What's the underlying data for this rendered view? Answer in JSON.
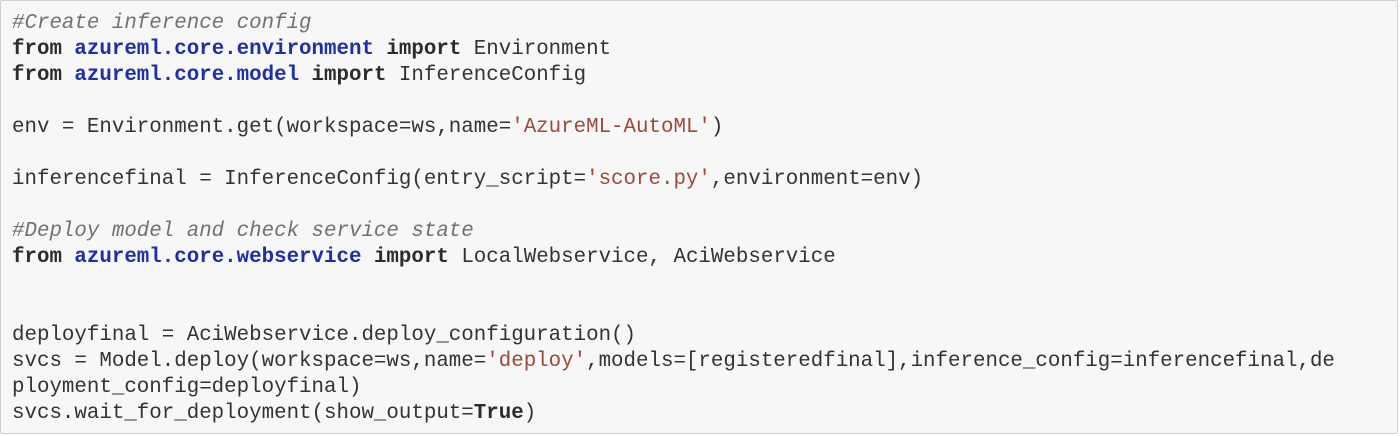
{
  "colors": {
    "background": "#f7f7f7",
    "border": "#cfcfcf",
    "text": "#333333",
    "comment": "#717171",
    "keyword": "#2c2c2c",
    "module": "#1e2fa8",
    "string": "#9a4a3a"
  },
  "code": {
    "l1": {
      "comment": "#Create inference config"
    },
    "l2": {
      "kw1": "from",
      "module": "azureml.core.environment",
      "kw2": "import",
      "name": "Environment"
    },
    "l3": {
      "kw1": "from",
      "module": "azureml.core.model",
      "kw2": "import",
      "name": "InferenceConfig"
    },
    "l5": {
      "pre": "env = Environment.get(workspace=ws,name=",
      "str": "'AzureML-AutoML'",
      "post": ")"
    },
    "l7": {
      "pre": "inferencefinal = InferenceConfig(entry_script=",
      "str": "'score.py'",
      "post": ",environment=env)"
    },
    "l9": {
      "comment": "#Deploy model and check service state"
    },
    "l10": {
      "kw1": "from",
      "module": "azureml.core.webservice",
      "kw2": "import",
      "name": "LocalWebservice, AciWebservice"
    },
    "l13": {
      "text": "deployfinal = AciWebservice.deploy_configuration()"
    },
    "l14": {
      "pre": "svcs = Model.deploy(workspace=ws,name=",
      "str": "'deploy'",
      "post": ",models=[registeredfinal],inference_config=inferencefinal,de"
    },
    "l15": {
      "text": "ployment_config=deployfinal)"
    },
    "l16": {
      "pre": "svcs.wait_for_deployment(show_output=",
      "builtin": "True",
      "post": ")"
    }
  }
}
